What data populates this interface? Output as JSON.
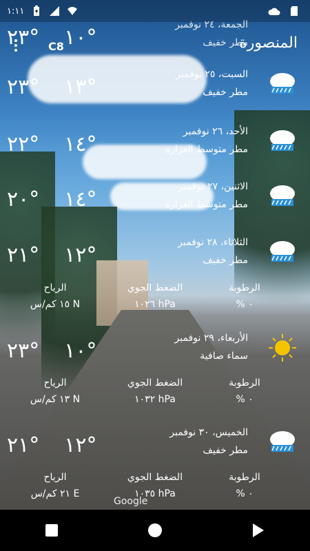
{
  "status_bar": {
    "time": "١:١١",
    "icons": [
      "battery-charging-icon",
      "signal-icon",
      "wifi-icon",
      "cloud-icon",
      "sd-card-icon"
    ]
  },
  "header": {
    "unit": "C8",
    "city": "المنصورة",
    "menu_icon": "overflow-menu-icon"
  },
  "forecast": [
    {
      "date": "الجمعة، ٢٤ نوفمبر",
      "condition": "مطر خفيف",
      "high": "°٢٣",
      "low": "°١٠",
      "icon": "rain-cloud-icon"
    },
    {
      "date": "السبت، ٢٥ نوفمبر",
      "condition": "مطر خفيف",
      "high": "°٢٣",
      "low": "°١٣",
      "icon": "rain-cloud-icon"
    },
    {
      "date": "الأحد، ٢٦ نوفمبر",
      "condition": "مطر متوسط الغزارة",
      "high": "°٢٢",
      "low": "°١٤",
      "icon": "rain-cloud-icon"
    },
    {
      "date": "الاثنين، ٢٧ نوفمبر",
      "condition": "مطر متوسط الغزارة",
      "high": "°٢٠",
      "low": "°١٤",
      "icon": "rain-cloud-icon"
    },
    {
      "date": "الثلاثاء، ٢٨ نوفمبر",
      "condition": "مطر خفيف",
      "high": "°٢١",
      "low": "°١٢",
      "icon": "rain-cloud-icon"
    },
    {
      "date": "الأربعاء، ٢٩ نوفمبر",
      "condition": "سماء صافية",
      "high": "°٢٣",
      "low": "°١٠",
      "icon": "sun-icon"
    },
    {
      "date": "الخميس، ٣٠ نوفمبر",
      "condition": "مطر خفيف",
      "high": "°٢١",
      "low": "°١٢",
      "icon": "rain-cloud-icon"
    }
  ],
  "details": [
    {
      "humidity_label": "الرطوبة",
      "humidity": "% ٠",
      "pressure_label": "الضغط الجوي",
      "pressure": "١٠٢٦ hPa",
      "wind_label": "الرياح",
      "wind": "١٥ كم/س N"
    },
    {
      "humidity_label": "الرطوبة",
      "humidity": "% ٠",
      "pressure_label": "الضغط الجوي",
      "pressure": "١٠٣٢ hPa",
      "wind_label": "الرياح",
      "wind": "١٣ كم/س N"
    },
    {
      "humidity_label": "الرطوبة",
      "humidity": "% ٠",
      "pressure_label": "الضغط الجوي",
      "pressure": "١٠٣٥ hPa",
      "wind_label": "الرياح",
      "wind": "٢١ كم/س E"
    }
  ],
  "attribution": "Google",
  "nav": {
    "recent_icon": "recent-apps-icon",
    "home_icon": "home-icon",
    "back_icon": "back-icon"
  }
}
